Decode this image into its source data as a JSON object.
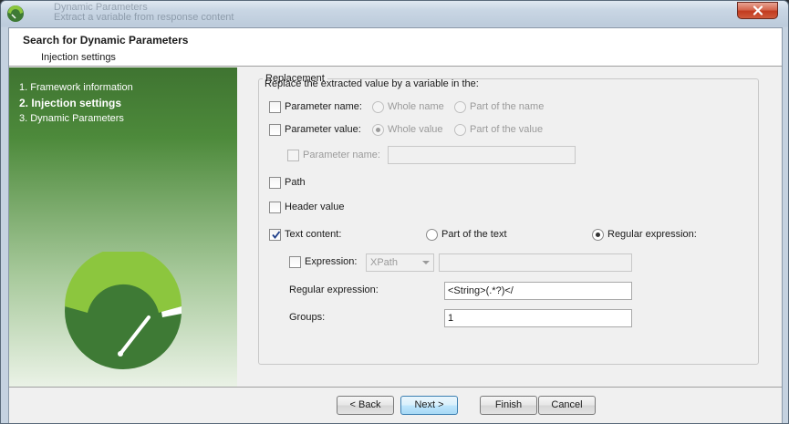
{
  "window": {
    "title_blur_line1": "Dynamic Parameters",
    "title_blur_line2": "Extract a variable from response content"
  },
  "header": {
    "title": "Search for Dynamic Parameters",
    "subtitle": "Injection settings"
  },
  "sidebar": {
    "steps": [
      {
        "label": "1. Framework information",
        "active": false
      },
      {
        "label": "2. Injection settings",
        "active": true
      },
      {
        "label": "3. Dynamic Parameters",
        "active": false
      }
    ]
  },
  "replacement": {
    "legend": "Replacement",
    "intro": "Replace the extracted value by a variable in the:",
    "parameter_name": {
      "label": "Parameter name:",
      "checked": false,
      "whole": "Whole name",
      "part": "Part of the name"
    },
    "parameter_value": {
      "label": "Parameter value:",
      "checked": false,
      "whole": "Whole value",
      "part": "Part of the value",
      "selected": "whole"
    },
    "sub_parameter_name": {
      "label": "Parameter name:",
      "checked": false,
      "value": ""
    },
    "path": {
      "label": "Path",
      "checked": false
    },
    "header_value": {
      "label": "Header value",
      "checked": false
    },
    "text_content": {
      "label": "Text content:",
      "checked": true,
      "part": "Part of the text",
      "regex": "Regular expression:",
      "selected": "regex"
    },
    "expression": {
      "label": "Expression:",
      "checked": false,
      "type": "XPath",
      "value": ""
    },
    "regular_expression": {
      "label": "Regular expression:",
      "value": "<String>(.*?)</"
    },
    "groups": {
      "label": "Groups:",
      "value": "1"
    }
  },
  "footer": {
    "back": "< Back",
    "next": "Next >",
    "finish": "Finish",
    "cancel": "Cancel"
  },
  "colors": {
    "sidebar_dark": "#3f7431",
    "logo_lime": "#8cc63e",
    "logo_green": "#3e7a35"
  }
}
